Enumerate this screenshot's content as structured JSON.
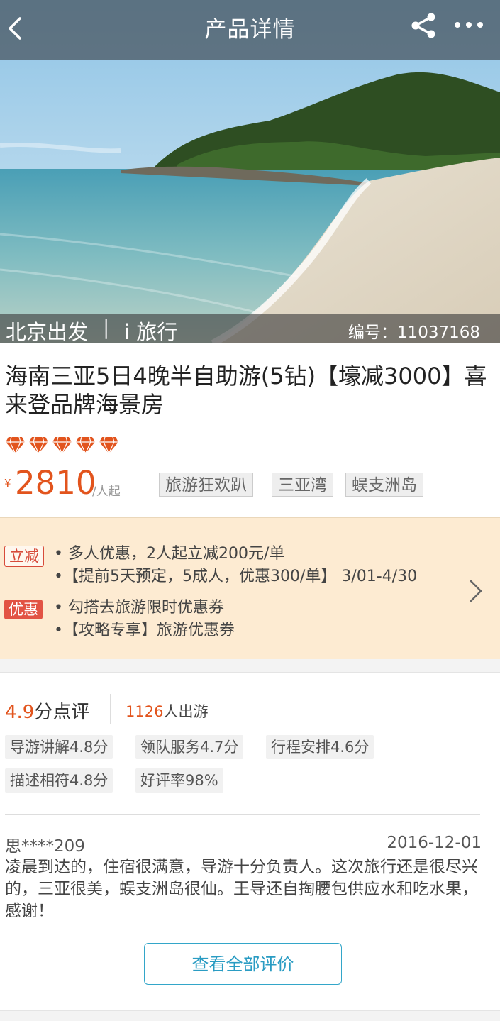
{
  "header": {
    "title": "产品详情",
    "icons": [
      "back-arrow-icon",
      "share-icon",
      "more-icon"
    ]
  },
  "hero": {
    "departure": "北京出发",
    "separator": "|",
    "brand": "i 旅行",
    "code": "编号：11037168"
  },
  "product": {
    "title": "海南三亚5日4晚半自助游(5钻)【壕减3000】喜来登品牌海景房",
    "diamond_rating": 5,
    "currency": "¥",
    "price": "2810",
    "price_unit": "/人起",
    "tags": [
      "旅游狂欢趴",
      "三亚湾",
      "蜈支洲岛"
    ]
  },
  "promo": {
    "badge_discount": "立减",
    "badge_offer": "优惠",
    "lines": [
      "• 多人优惠，2人起立减200元/单",
      "•【提前5天预定，5成人，优惠300/单】  3/01-4/30",
      "• 勾搭去旅游限时优惠券",
      "•【攻略专享】旅游优惠券"
    ]
  },
  "reviews": {
    "score": "4.9",
    "score_label": "分点评",
    "travelers": "1126",
    "travelers_label": "人出游",
    "chips": [
      "导游讲解4.8分",
      "领队服务4.7分",
      "行程安排4.6分",
      "描述相符4.8分",
      "好评率98%"
    ],
    "user": "思****209",
    "date": "2016-12-01",
    "text": "凌晨到达的，住宿很满意，导游十分负责人。这次旅行还是很尽兴的，三亚很美，蜈支洲岛很仙。王导还自掏腰包供应水和吃水果，感谢！",
    "view_all": "查看全部评价"
  },
  "colors": {
    "accent": "#e2541d",
    "link": "#2a9cc3",
    "promo_bg": "#fdebd2"
  }
}
